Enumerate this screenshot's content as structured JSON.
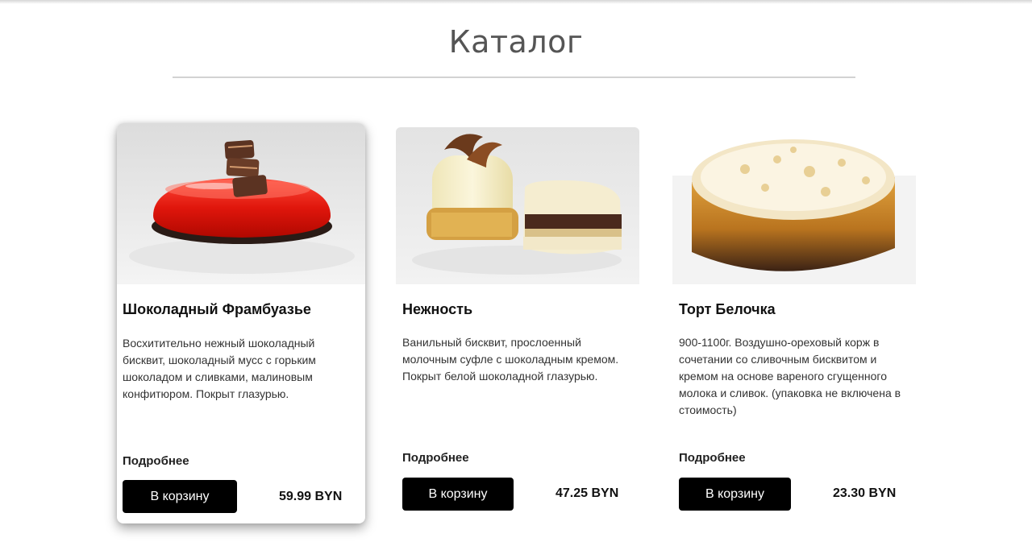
{
  "catalog": {
    "title": "Каталог"
  },
  "products": [
    {
      "name": "Шоколадный Фрамбуазье",
      "description": "Восхитительно нежный шоколадный бисквит, шоколадный мусс с горьким шоколадом и сливками, малиновым конфитюром. Покрыт глазурью.",
      "more_label": "Подробнее",
      "cart_label": "В корзину",
      "price": "59.99 BYN"
    },
    {
      "name": "Нежность",
      "description": "Ванильный бисквит, прослоенный молочным суфле с шоколадным кремом. Покрыт белой шоколадной глазурью.",
      "more_label": "Подробнее",
      "cart_label": "В корзину",
      "price": "47.25 BYN"
    },
    {
      "name": "Торт Белочка",
      "description": "900-1100г. Воздушно-ореховый корж в сочетании со сливочным бисквитом и кремом на основе вареного сгущенного молока и сливок. (упаковка не включена в стоимость)",
      "more_label": "Подробнее",
      "cart_label": "В корзину",
      "price": "23.30 BYN"
    }
  ],
  "colors": {
    "button_bg": "#000000",
    "button_text": "#ffffff",
    "title_text": "#555555",
    "divider": "#d2d2d2"
  }
}
